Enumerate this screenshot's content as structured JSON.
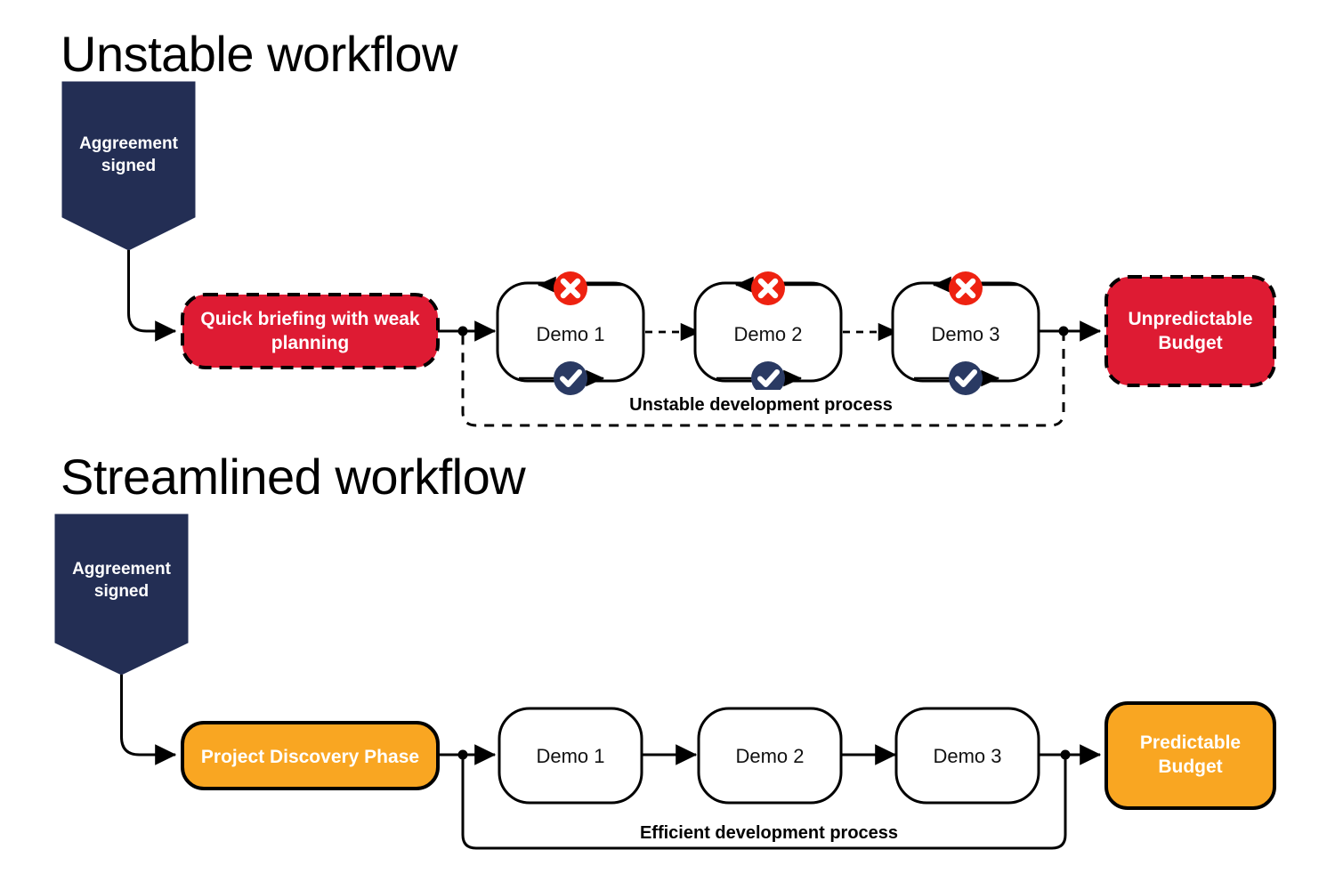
{
  "document": {
    "title": "Unstable vs Streamlined workflow comparison"
  },
  "colors": {
    "navy": "#232E54",
    "red": "#DE1B33",
    "orange": "#F9A622",
    "badge_red": "#EE2211",
    "badge_navy": "#2A3A63",
    "ink": "#000000",
    "white": "#FFFFFF",
    "background": "#FFFFFF"
  },
  "sections": [
    {
      "id": "unstable",
      "title": "Unstable workflow",
      "banner": {
        "line1": "Aggreement",
        "line2": "signed"
      },
      "start_node": {
        "line1": "Quick briefing with weak",
        "line2": "planning",
        "fill": "#DE1B33",
        "border_style": "dashed"
      },
      "demos": [
        {
          "label": "Demo 1",
          "top_badge": "x-circle-icon",
          "bottom_badge": "check-circle-icon"
        },
        {
          "label": "Demo 2",
          "top_badge": "x-circle-icon",
          "bottom_badge": "check-circle-icon"
        },
        {
          "label": "Demo 3",
          "top_badge": "x-circle-icon",
          "bottom_badge": "check-circle-icon"
        }
      ],
      "connector_style": "dashed",
      "loop_label": "Unstable development process",
      "loop_style": "dashed",
      "end_node": {
        "line1": "Unpredictable",
        "line2": "Budget",
        "fill": "#DE1B33",
        "border_style": "dashed"
      }
    },
    {
      "id": "streamlined",
      "title": "Streamlined workflow",
      "banner": {
        "line1": "Aggreement",
        "line2": "signed"
      },
      "start_node": {
        "line1": "Project Discovery Phase",
        "line2": "",
        "fill": "#F9A622",
        "border_style": "solid"
      },
      "demos": [
        {
          "label": "Demo 1",
          "top_badge": "",
          "bottom_badge": ""
        },
        {
          "label": "Demo 2",
          "top_badge": "",
          "bottom_badge": ""
        },
        {
          "label": "Demo 3",
          "top_badge": "",
          "bottom_badge": ""
        }
      ],
      "connector_style": "solid",
      "loop_label": "Efficient development process",
      "loop_style": "solid",
      "end_node": {
        "line1": "Predictable",
        "line2": "Budget",
        "fill": "#F9A622",
        "border_style": "solid"
      }
    }
  ]
}
